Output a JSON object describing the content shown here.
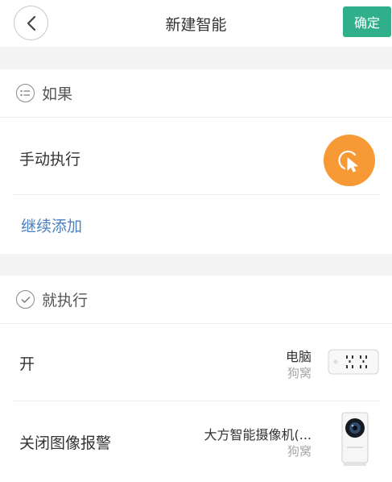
{
  "header": {
    "title": "新建智能",
    "confirm_label": "确定"
  },
  "if_section": {
    "heading": "如果",
    "trigger_label": "手动执行",
    "add_more_label": "继续添加"
  },
  "then_section": {
    "heading": "就执行",
    "actions": [
      {
        "label": "开",
        "device_name": "电脑",
        "device_room": "狗窝",
        "device_icon": "power-strip-icon"
      },
      {
        "label": "关闭图像报警",
        "device_name": "大方智能摄像机(...",
        "device_room": "狗窝",
        "device_icon": "camera-icon"
      }
    ]
  },
  "colors": {
    "accent": "#2fb08a",
    "fab": "#f79a36",
    "link": "#4a7fc1"
  }
}
